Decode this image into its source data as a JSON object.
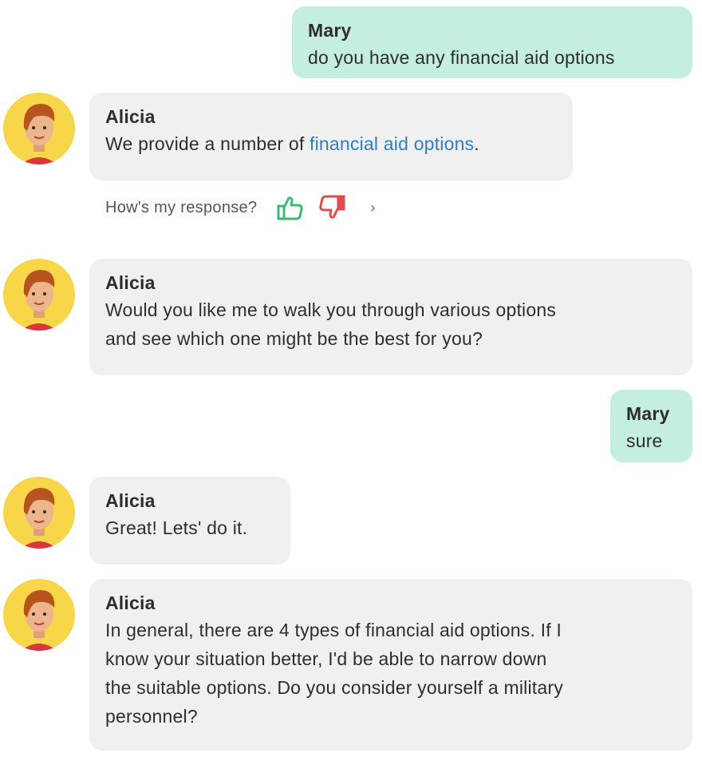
{
  "messages": [
    {
      "sender": "Mary",
      "text": "do you have any financial aid options"
    },
    {
      "sender": "Alicia",
      "text_before": "We provide a number of ",
      "link_text": "financial aid options",
      "text_after": "."
    },
    {
      "sender": "Alicia",
      "lines": [
        "Would you like me to walk you through various options",
        "and see which one might be the best for you?"
      ]
    },
    {
      "sender": "Mary",
      "text": "sure"
    },
    {
      "sender": "Alicia",
      "text": "Great! Lets' do it."
    },
    {
      "sender": "Alicia",
      "lines": [
        "In general, there are 4 types of financial aid options. If I",
        "know your situation better, I'd be able to narrow down",
        "the suitable options. Do you consider yourself a military",
        "personnel?"
      ]
    }
  ],
  "feedback": {
    "label": "How's my response?",
    "more": "›"
  },
  "icons": {
    "thumbs_up": "thumbs-up-icon",
    "thumbs_down": "thumbs-down-icon",
    "avatar": "alicia-avatar"
  },
  "colors": {
    "user_bubble": "#c4eedf",
    "agent_bubble": "#f0f0f0",
    "link": "#2f7fbf",
    "thumb_up": "#3dbb73",
    "thumb_down": "#e04b4b",
    "avatar_bg": "#f7d64a"
  }
}
